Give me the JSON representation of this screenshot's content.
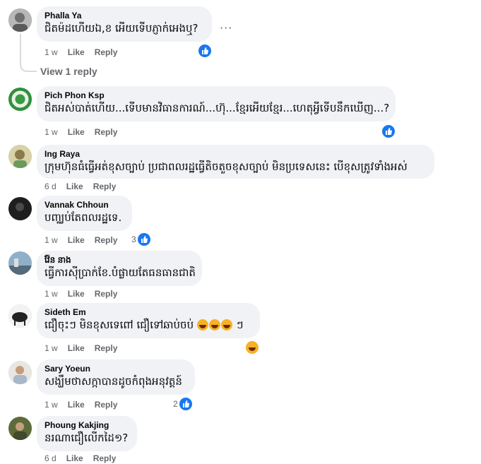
{
  "comments": [
    {
      "author": "Phalla Ya",
      "text": "ជិតម៉ដហើយឯ,ខ អើយទើបភ្ញាក់អេងឬ?",
      "time": "1 w",
      "like": "Like",
      "reply": "Reply",
      "reaction_count": ""
    },
    {
      "author": "Pich Phon Ksp",
      "text": "ជិតអស់បាត់ហើយ...ទើបមានវិធានការណ៍...ហ៊ុ...ខ្មែរអើយខ្មែរ...ហេតុអ្វីទើបនឹកឃើញ...?",
      "time": "1 w",
      "like": "Like",
      "reply": "Reply",
      "reaction_count": ""
    },
    {
      "author": "Ing Raya",
      "text": "ក្រុមហ៊ុនធំធ្វើអត់ខុសច្បាប់ ប្រជាពលរដ្ឋធ្វើតិចតួចខុសច្បាប់ មិនប្រទេសនេះ បើខុសត្រូវទាំងអស់",
      "time": "6 d",
      "like": "Like",
      "reply": "Reply",
      "reaction_count": ""
    },
    {
      "author": "Vannak Chhoun",
      "text": "បញ្ឈប់តែពលរដ្ឋទេ.",
      "time": "1 w",
      "like": "Like",
      "reply": "Reply",
      "reaction_count": "3"
    },
    {
      "author": "វ៉ែន នាង",
      "text": "ធ្វើការស៊ីប្រាក់ខែ.បំផ្លាយតែធនធានជាតិ",
      "time": "1 w",
      "like": "Like",
      "reply": "Reply",
      "reaction_count": ""
    },
    {
      "author": "Sideth Em",
      "text": "ជឿចុះៗ មិនខុសទេពៅ ជឿទៅឆាប់ចប់",
      "text_suffix": "ៗ",
      "time": "1 w",
      "like": "Like",
      "reply": "Reply",
      "reaction_count": ""
    },
    {
      "author": "Sary Yoeun",
      "text": "សង្ឃឹមថាសក្កាបានដូចកំពុងអនុវត្តន៍",
      "time": "1 w",
      "like": "Like",
      "reply": "Reply",
      "reaction_count": "2"
    },
    {
      "author": "Phoung Kakjing",
      "text": "នរណាជឿលើកដៃ១?",
      "time": "6 d",
      "like": "Like",
      "reply": "Reply",
      "reaction_count": ""
    }
  ],
  "view_reply_label": "View 1 reply",
  "more_label": "···",
  "colors": {
    "like_blue": "#1877f2",
    "bubble": "#f0f2f5",
    "meta": "#65676b",
    "haha": "#f7b125"
  },
  "icons": {
    "like": "thumbs-up-icon",
    "haha": "haha-emoji-icon",
    "more": "more-options-icon"
  }
}
